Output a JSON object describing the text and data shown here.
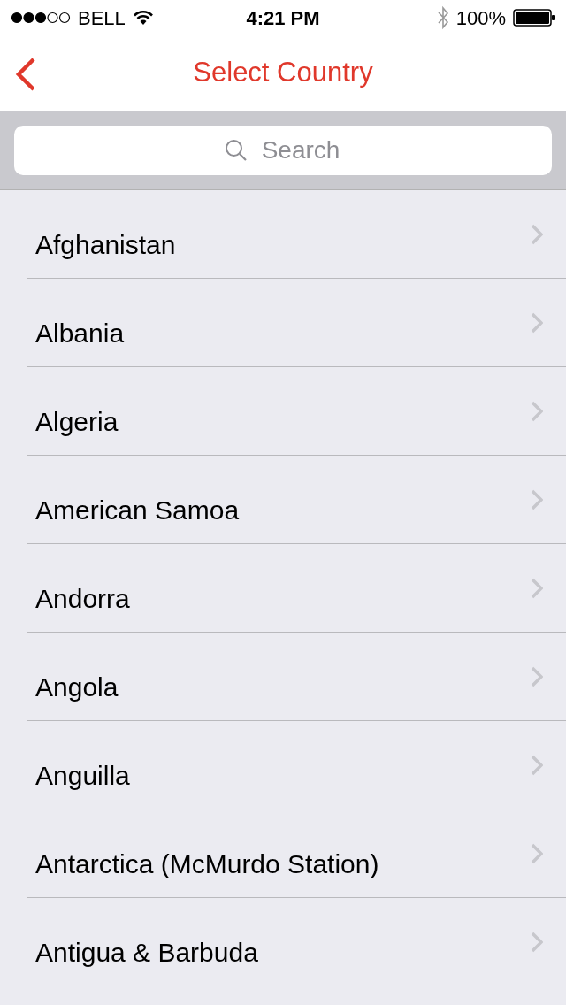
{
  "status_bar": {
    "carrier": "BELL",
    "time": "4:21 PM",
    "battery": "100%"
  },
  "nav": {
    "title": "Select Country"
  },
  "search": {
    "placeholder": "Search"
  },
  "countries": [
    {
      "name": "Afghanistan"
    },
    {
      "name": "Albania"
    },
    {
      "name": "Algeria"
    },
    {
      "name": "American Samoa"
    },
    {
      "name": "Andorra"
    },
    {
      "name": "Angola"
    },
    {
      "name": "Anguilla"
    },
    {
      "name": "Antarctica (McMurdo Station)"
    },
    {
      "name": "Antigua & Barbuda"
    }
  ]
}
